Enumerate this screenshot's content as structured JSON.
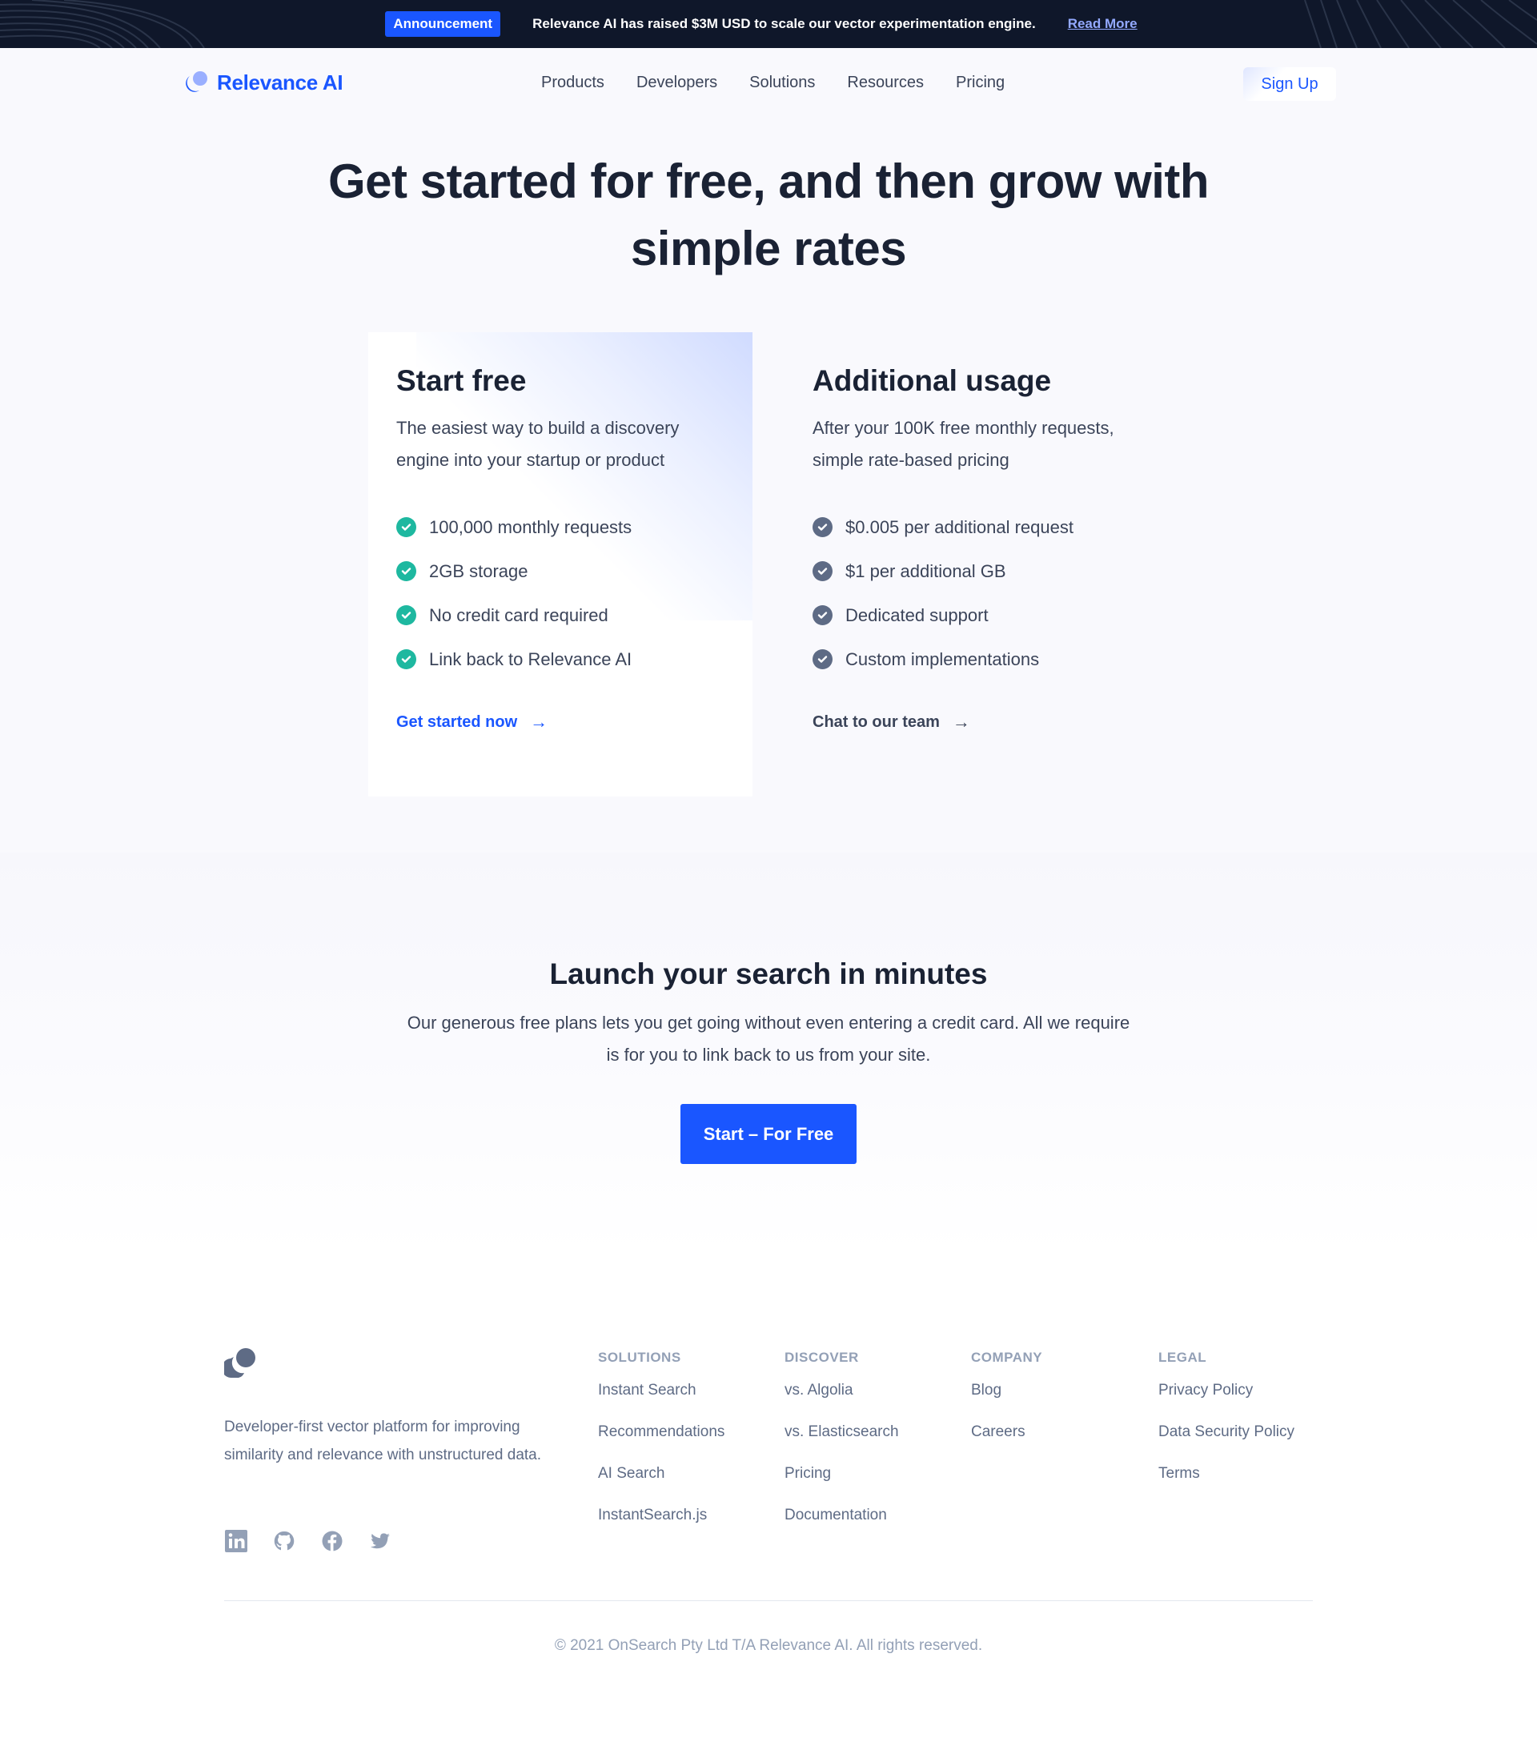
{
  "announcement": {
    "badge": "Announcement",
    "text": "Relevance AI has raised $3M USD to scale our vector experimentation engine.",
    "link": "Read More"
  },
  "nav": {
    "brand": "Relevance AI",
    "links": [
      "Products",
      "Developers",
      "Solutions",
      "Resources",
      "Pricing"
    ],
    "signup": "Sign Up"
  },
  "hero": {
    "title": "Get started for free, and then grow with simple rates"
  },
  "plans": [
    {
      "title": "Start free",
      "subtitle": "The easiest way to build a discovery engine into your startup or product",
      "features": [
        "100,000 monthly requests",
        "2GB storage",
        "No credit card required",
        "Link back to Relevance AI"
      ],
      "cta": "Get started now",
      "check_color": "#1eb8a0"
    },
    {
      "title": "Additional usage",
      "subtitle": "After your 100K free monthly requests, simple rate-based pricing",
      "features": [
        "$0.005 per additional request",
        "$1 per additional GB",
        "Dedicated support",
        "Custom implementations"
      ],
      "cta": "Chat to our team",
      "check_color": "#5e6b85"
    }
  ],
  "launch": {
    "title": "Launch your search in minutes",
    "subtitle": "Our generous free plans lets you get going without even entering a credit card. All we require is for you to link back to us from your site.",
    "button": "Start – For Free"
  },
  "footer": {
    "description": "Developer-first vector platform for improving similarity and relevance with unstructured data.",
    "socials": [
      "linkedin",
      "github",
      "facebook",
      "twitter"
    ],
    "columns": [
      {
        "title": "SOLUTIONS",
        "links": [
          "Instant Search",
          "Recommendations",
          "AI Search",
          "InstantSearch.js"
        ]
      },
      {
        "title": "DISCOVER",
        "links": [
          "vs. Algolia",
          "vs. Elasticsearch",
          "Pricing",
          "Documentation"
        ]
      },
      {
        "title": "COMPANY",
        "links": [
          "Blog",
          "Careers"
        ]
      },
      {
        "title": "LEGAL",
        "links": [
          "Privacy Policy",
          "Data Security Policy",
          "Terms"
        ]
      }
    ],
    "copyright": "© 2021 OnSearch Pty Ltd T/A Relevance AI. All rights reserved."
  },
  "colors": {
    "brand": "#1a56ff",
    "dark": "#0f172a",
    "text": "#1a2234",
    "muted": "#5e6b85",
    "teal": "#1eb8a0"
  }
}
